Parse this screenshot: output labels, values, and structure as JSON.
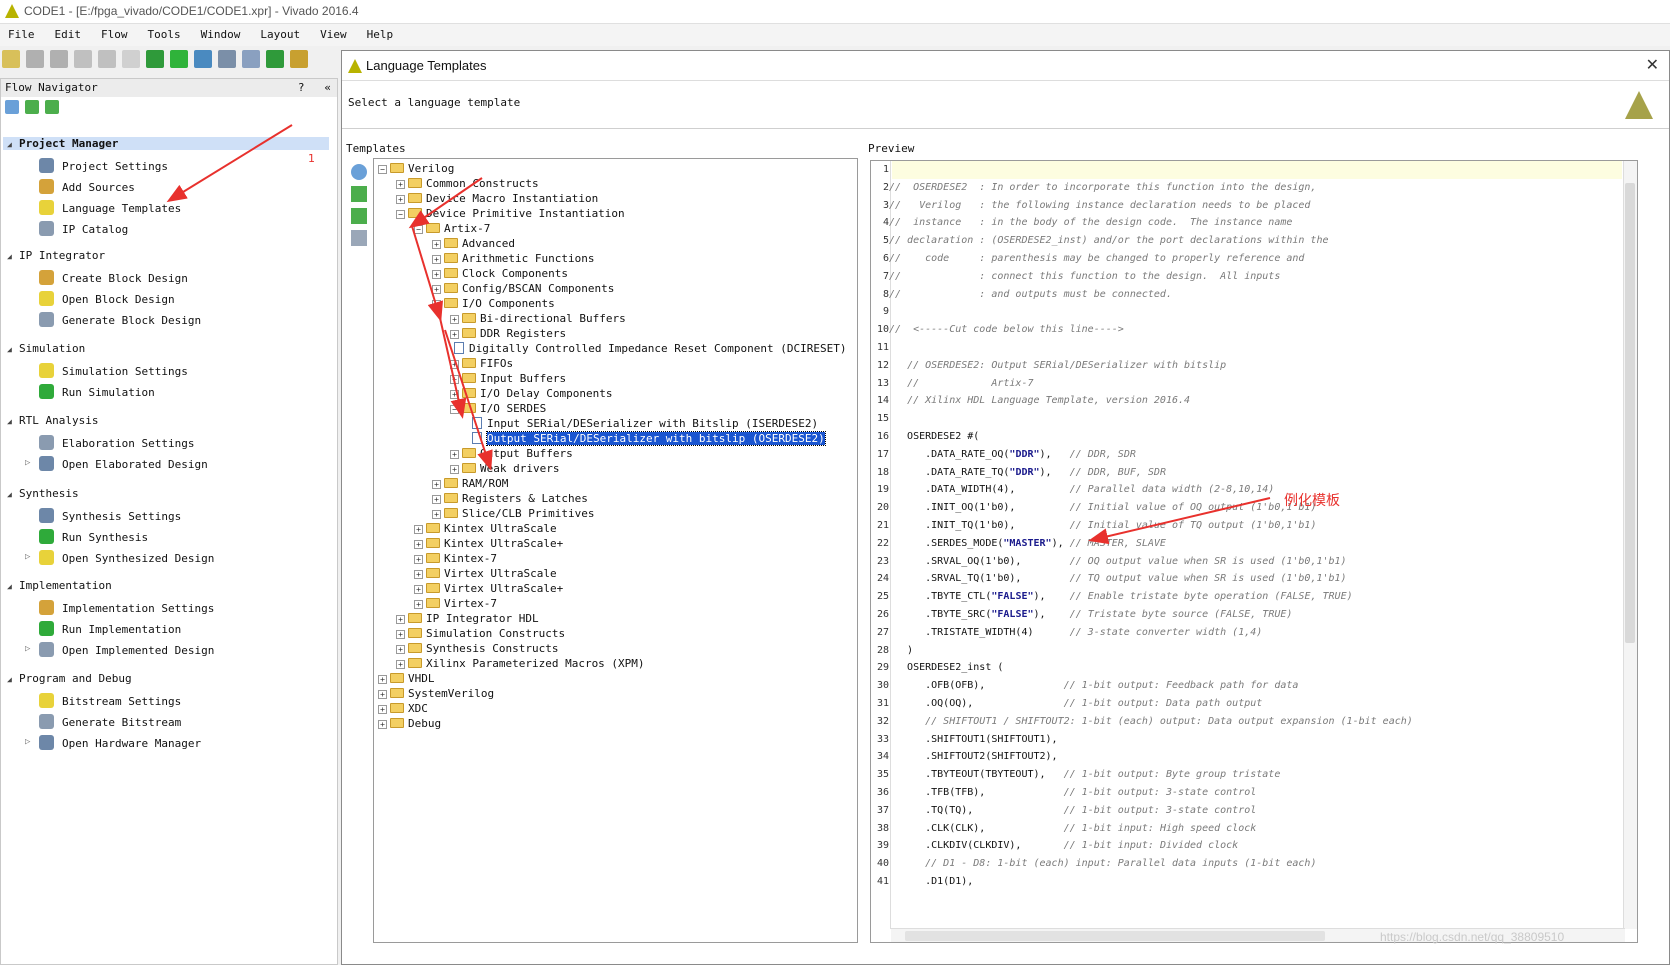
{
  "window": {
    "title": "CODE1 - [E:/fpga_vivado/CODE1/CODE1.xpr] - Vivado 2016.4"
  },
  "menu": [
    "File",
    "Edit",
    "Flow",
    "Tools",
    "Window",
    "Layout",
    "View",
    "Help"
  ],
  "flow_navigator": {
    "title": "Flow Navigator",
    "help": "?",
    "collapse": "«",
    "groups": [
      {
        "title": "Project Manager",
        "items": [
          "Project Settings",
          "Add Sources",
          "Language Templates",
          "IP Catalog"
        ]
      },
      {
        "title": "IP Integrator",
        "items": [
          "Create Block Design",
          "Open Block Design",
          "Generate Block Design"
        ]
      },
      {
        "title": "Simulation",
        "items": [
          "Simulation Settings",
          "Run Simulation"
        ]
      },
      {
        "title": "RTL Analysis",
        "items": [
          "Elaboration Settings",
          "Open Elaborated Design"
        ]
      },
      {
        "title": "Synthesis",
        "items": [
          "Synthesis Settings",
          "Run Synthesis",
          "Open Synthesized Design"
        ]
      },
      {
        "title": "Implementation",
        "items": [
          "Implementation Settings",
          "Run Implementation",
          "Open Implemented Design"
        ]
      },
      {
        "title": "Program and Debug",
        "items": [
          "Bitstream Settings",
          "Generate Bitstream",
          "Open Hardware Manager"
        ]
      }
    ]
  },
  "dialog": {
    "title": "Language Templates",
    "close": "✕",
    "subtitle": "Select a language template",
    "templates_label": "Templates",
    "preview_label": "Preview"
  },
  "tree": [
    {
      "d": 0,
      "t": "Verilog",
      "k": "open"
    },
    {
      "d": 1,
      "t": "Common Constructs",
      "k": "closed"
    },
    {
      "d": 1,
      "t": "Device Macro Instantiation",
      "k": "closed"
    },
    {
      "d": 1,
      "t": "Device Primitive Instantiation",
      "k": "open"
    },
    {
      "d": 2,
      "t": "Artix-7",
      "k": "open"
    },
    {
      "d": 3,
      "t": "Advanced",
      "k": "closed"
    },
    {
      "d": 3,
      "t": "Arithmetic Functions",
      "k": "closed"
    },
    {
      "d": 3,
      "t": "Clock Components",
      "k": "closed"
    },
    {
      "d": 3,
      "t": "Config/BSCAN Components",
      "k": "closed"
    },
    {
      "d": 3,
      "t": "I/O Components",
      "k": "open"
    },
    {
      "d": 4,
      "t": "Bi-directional Buffers",
      "k": "closed"
    },
    {
      "d": 4,
      "t": "DDR Registers",
      "k": "closed"
    },
    {
      "d": 4,
      "t": "Digitally Controlled Impedance Reset Component (DCIRESET)",
      "k": "file"
    },
    {
      "d": 4,
      "t": "FIFOs",
      "k": "closed"
    },
    {
      "d": 4,
      "t": "Input Buffers",
      "k": "closed"
    },
    {
      "d": 4,
      "t": "I/O Delay Components",
      "k": "closed"
    },
    {
      "d": 4,
      "t": "I/O SERDES",
      "k": "open"
    },
    {
      "d": 5,
      "t": "Input SERial/DESerializer with Bitslip (ISERDESE2)",
      "k": "file"
    },
    {
      "d": 5,
      "t": "Output SERial/DESerializer with bitslip (OSERDESE2)",
      "k": "file",
      "sel": true
    },
    {
      "d": 4,
      "t": "Output Buffers",
      "k": "closed"
    },
    {
      "d": 4,
      "t": "Weak drivers",
      "k": "closed"
    },
    {
      "d": 3,
      "t": "RAM/ROM",
      "k": "closed"
    },
    {
      "d": 3,
      "t": "Registers & Latches",
      "k": "closed"
    },
    {
      "d": 3,
      "t": "Slice/CLB Primitives",
      "k": "closed"
    },
    {
      "d": 2,
      "t": "Kintex UltraScale",
      "k": "closed"
    },
    {
      "d": 2,
      "t": "Kintex UltraScale+",
      "k": "closed"
    },
    {
      "d": 2,
      "t": "Kintex-7",
      "k": "closed"
    },
    {
      "d": 2,
      "t": "Virtex UltraScale",
      "k": "closed"
    },
    {
      "d": 2,
      "t": "Virtex UltraScale+",
      "k": "closed"
    },
    {
      "d": 2,
      "t": "Virtex-7",
      "k": "closed"
    },
    {
      "d": 1,
      "t": "IP Integrator HDL",
      "k": "closed"
    },
    {
      "d": 1,
      "t": "Simulation Constructs",
      "k": "closed"
    },
    {
      "d": 1,
      "t": "Synthesis Constructs",
      "k": "closed"
    },
    {
      "d": 1,
      "t": "Xilinx Parameterized Macros (XPM)",
      "k": "closed"
    },
    {
      "d": 0,
      "t": "VHDL",
      "k": "closed"
    },
    {
      "d": 0,
      "t": "SystemVerilog",
      "k": "closed"
    },
    {
      "d": 0,
      "t": "XDC",
      "k": "closed"
    },
    {
      "d": 0,
      "t": "Debug",
      "k": "closed"
    }
  ],
  "code": [
    "",
    "//  OSERDESE2  : In order to incorporate this function into the design,",
    "//   Verilog   : the following instance declaration needs to be placed",
    "//  instance   : in the body of the design code.  The instance name",
    "// declaration : (OSERDESE2_inst) and/or the port declarations within the",
    "//    code     : parenthesis may be changed to properly reference and",
    "//             : connect this function to the design.  All inputs",
    "//             : and outputs must be connected.",
    "",
    "//  <-----Cut code below this line---->",
    "",
    "   // OSERDESE2: Output SERial/DESerializer with bitslip",
    "   //            Artix-7",
    "   // Xilinx HDL Language Template, version 2016.4",
    "",
    "   OSERDESE2 #(",
    "      .DATA_RATE_OQ(\"DDR\"),   // DDR, SDR",
    "      .DATA_RATE_TQ(\"DDR\"),   // DDR, BUF, SDR",
    "      .DATA_WIDTH(4),         // Parallel data width (2-8,10,14)",
    "      .INIT_OQ(1'b0),         // Initial value of OQ output (1'b0,1'b1)",
    "      .INIT_TQ(1'b0),         // Initial value of TQ output (1'b0,1'b1)",
    "      .SERDES_MODE(\"MASTER\"), // MASTER, SLAVE",
    "      .SRVAL_OQ(1'b0),        // OQ output value when SR is used (1'b0,1'b1)",
    "      .SRVAL_TQ(1'b0),        // TQ output value when SR is used (1'b0,1'b1)",
    "      .TBYTE_CTL(\"FALSE\"),    // Enable tristate byte operation (FALSE, TRUE)",
    "      .TBYTE_SRC(\"FALSE\"),    // Tristate byte source (FALSE, TRUE)",
    "      .TRISTATE_WIDTH(4)      // 3-state converter width (1,4)",
    "   )",
    "   OSERDESE2_inst (",
    "      .OFB(OFB),             // 1-bit output: Feedback path for data",
    "      .OQ(OQ),               // 1-bit output: Data path output",
    "      // SHIFTOUT1 / SHIFTOUT2: 1-bit (each) output: Data output expansion (1-bit each)",
    "      .SHIFTOUT1(SHIFTOUT1),",
    "      .SHIFTOUT2(SHIFTOUT2),",
    "      .TBYTEOUT(TBYTEOUT),   // 1-bit output: Byte group tristate",
    "      .TFB(TFB),             // 1-bit output: 3-state control",
    "      .TQ(TQ),               // 1-bit output: 3-state control",
    "      .CLK(CLK),             // 1-bit input: High speed clock",
    "      .CLKDIV(CLKDIV),       // 1-bit input: Divided clock",
    "      // D1 - D8: 1-bit (each) input: Parallel data inputs (1-bit each)",
    "      .D1(D1),"
  ],
  "annotations": {
    "label_1": "1",
    "label_template": "例化模板"
  },
  "watermark": "https://blog.csdn.net/qq_38809510",
  "colors": {
    "selection": "#1a55d0",
    "arrow": "#e8312d",
    "folder": "#f3cf62"
  }
}
